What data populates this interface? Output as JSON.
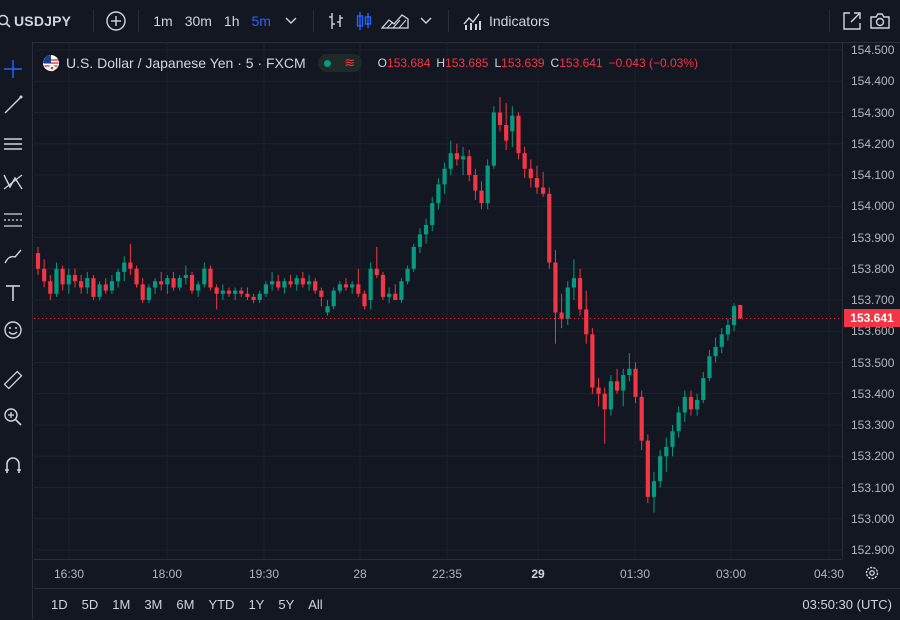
{
  "toolbar": {
    "symbol": "USDJPY",
    "intervals": [
      "1m",
      "30m",
      "1h",
      "5m"
    ],
    "active_interval": "5m",
    "indicators_label": "Indicators"
  },
  "legend": {
    "title": "U.S. Dollar / Japanese Yen · 5 · FXCM",
    "pill_symbol": "≋",
    "o_key": "O",
    "o_val": "153.684",
    "h_key": "H",
    "h_val": "153.685",
    "l_key": "L",
    "l_val": "153.639",
    "c_key": "C",
    "c_val": "153.641",
    "change": "−0.043 (−0.03%)"
  },
  "colors": {
    "up": "#089981",
    "down": "#f23645",
    "accent": "#2962ff",
    "background": "#131722"
  },
  "chart_data": {
    "type": "candlestick",
    "symbol": "USDJPY",
    "interval": "5",
    "ylim": [
      152.9,
      154.5
    ],
    "y_ticks": [
      "154.500",
      "154.400",
      "154.300",
      "154.200",
      "154.100",
      "154.000",
      "153.900",
      "153.800",
      "153.700",
      "153.600",
      "153.500",
      "153.400",
      "153.300",
      "153.200",
      "153.100",
      "153.000",
      "152.900"
    ],
    "x_ticks": [
      "16:30",
      "18:00",
      "19:30",
      "28",
      "22:35",
      "29",
      "01:30",
      "03:00",
      "04:30"
    ],
    "last_price": "153.641",
    "candles": [
      {
        "o": 153.85,
        "h": 153.87,
        "l": 153.78,
        "c": 153.8
      },
      {
        "o": 153.8,
        "h": 153.83,
        "l": 153.74,
        "c": 153.76
      },
      {
        "o": 153.76,
        "h": 153.78,
        "l": 153.7,
        "c": 153.72
      },
      {
        "o": 153.72,
        "h": 153.82,
        "l": 153.71,
        "c": 153.8
      },
      {
        "o": 153.8,
        "h": 153.81,
        "l": 153.73,
        "c": 153.75
      },
      {
        "o": 153.75,
        "h": 153.8,
        "l": 153.72,
        "c": 153.78
      },
      {
        "o": 153.78,
        "h": 153.8,
        "l": 153.74,
        "c": 153.76
      },
      {
        "o": 153.76,
        "h": 153.78,
        "l": 153.72,
        "c": 153.74
      },
      {
        "o": 153.74,
        "h": 153.79,
        "l": 153.72,
        "c": 153.77
      },
      {
        "o": 153.77,
        "h": 153.78,
        "l": 153.7,
        "c": 153.71
      },
      {
        "o": 153.71,
        "h": 153.76,
        "l": 153.7,
        "c": 153.75
      },
      {
        "o": 153.75,
        "h": 153.77,
        "l": 153.72,
        "c": 153.73
      },
      {
        "o": 153.73,
        "h": 153.78,
        "l": 153.72,
        "c": 153.76
      },
      {
        "o": 153.76,
        "h": 153.8,
        "l": 153.74,
        "c": 153.79
      },
      {
        "o": 153.79,
        "h": 153.84,
        "l": 153.76,
        "c": 153.82
      },
      {
        "o": 153.82,
        "h": 153.88,
        "l": 153.78,
        "c": 153.8
      },
      {
        "o": 153.8,
        "h": 153.81,
        "l": 153.74,
        "c": 153.75
      },
      {
        "o": 153.75,
        "h": 153.77,
        "l": 153.69,
        "c": 153.7
      },
      {
        "o": 153.7,
        "h": 153.75,
        "l": 153.69,
        "c": 153.74
      },
      {
        "o": 153.74,
        "h": 153.77,
        "l": 153.72,
        "c": 153.76
      },
      {
        "o": 153.76,
        "h": 153.79,
        "l": 153.73,
        "c": 153.75
      },
      {
        "o": 153.75,
        "h": 153.78,
        "l": 153.72,
        "c": 153.77
      },
      {
        "o": 153.77,
        "h": 153.79,
        "l": 153.73,
        "c": 153.74
      },
      {
        "o": 153.74,
        "h": 153.78,
        "l": 153.73,
        "c": 153.77
      },
      {
        "o": 153.77,
        "h": 153.81,
        "l": 153.75,
        "c": 153.78
      },
      {
        "o": 153.78,
        "h": 153.79,
        "l": 153.72,
        "c": 153.73
      },
      {
        "o": 153.73,
        "h": 153.76,
        "l": 153.71,
        "c": 153.75
      },
      {
        "o": 153.75,
        "h": 153.82,
        "l": 153.74,
        "c": 153.8
      },
      {
        "o": 153.8,
        "h": 153.81,
        "l": 153.73,
        "c": 153.74
      },
      {
        "o": 153.74,
        "h": 153.75,
        "l": 153.67,
        "c": 153.72
      },
      {
        "o": 153.72,
        "h": 153.75,
        "l": 153.7,
        "c": 153.73
      },
      {
        "o": 153.73,
        "h": 153.74,
        "l": 153.71,
        "c": 153.72
      },
      {
        "o": 153.72,
        "h": 153.74,
        "l": 153.7,
        "c": 153.73
      },
      {
        "o": 153.73,
        "h": 153.74,
        "l": 153.71,
        "c": 153.72
      },
      {
        "o": 153.72,
        "h": 153.74,
        "l": 153.7,
        "c": 153.71
      },
      {
        "o": 153.71,
        "h": 153.72,
        "l": 153.69,
        "c": 153.7
      },
      {
        "o": 153.7,
        "h": 153.73,
        "l": 153.69,
        "c": 153.72
      },
      {
        "o": 153.72,
        "h": 153.76,
        "l": 153.71,
        "c": 153.75
      },
      {
        "o": 153.75,
        "h": 153.79,
        "l": 153.73,
        "c": 153.76
      },
      {
        "o": 153.76,
        "h": 153.78,
        "l": 153.73,
        "c": 153.74
      },
      {
        "o": 153.74,
        "h": 153.77,
        "l": 153.72,
        "c": 153.76
      },
      {
        "o": 153.76,
        "h": 153.78,
        "l": 153.74,
        "c": 153.75
      },
      {
        "o": 153.75,
        "h": 153.78,
        "l": 153.73,
        "c": 153.77
      },
      {
        "o": 153.77,
        "h": 153.79,
        "l": 153.74,
        "c": 153.75
      },
      {
        "o": 153.75,
        "h": 153.78,
        "l": 153.73,
        "c": 153.76
      },
      {
        "o": 153.76,
        "h": 153.77,
        "l": 153.72,
        "c": 153.73
      },
      {
        "o": 153.73,
        "h": 153.74,
        "l": 153.68,
        "c": 153.71
      },
      {
        "o": 153.66,
        "h": 153.7,
        "l": 153.65,
        "c": 153.68
      },
      {
        "o": 153.68,
        "h": 153.74,
        "l": 153.67,
        "c": 153.73
      },
      {
        "o": 153.73,
        "h": 153.76,
        "l": 153.72,
        "c": 153.75
      },
      {
        "o": 153.75,
        "h": 153.77,
        "l": 153.73,
        "c": 153.74
      },
      {
        "o": 153.74,
        "h": 153.76,
        "l": 153.72,
        "c": 153.75
      },
      {
        "o": 153.75,
        "h": 153.8,
        "l": 153.71,
        "c": 153.72
      },
      {
        "o": 153.72,
        "h": 153.73,
        "l": 153.67,
        "c": 153.68
      },
      {
        "o": 153.7,
        "h": 153.82,
        "l": 153.67,
        "c": 153.8
      },
      {
        "o": 153.8,
        "h": 153.87,
        "l": 153.77,
        "c": 153.78
      },
      {
        "o": 153.78,
        "h": 153.79,
        "l": 153.7,
        "c": 153.71
      },
      {
        "o": 153.71,
        "h": 153.74,
        "l": 153.69,
        "c": 153.72
      },
      {
        "o": 153.72,
        "h": 153.75,
        "l": 153.7,
        "c": 153.7
      },
      {
        "o": 153.7,
        "h": 153.77,
        "l": 153.69,
        "c": 153.76
      },
      {
        "o": 153.76,
        "h": 153.81,
        "l": 153.75,
        "c": 153.8
      },
      {
        "o": 153.8,
        "h": 153.88,
        "l": 153.79,
        "c": 153.87
      },
      {
        "o": 153.87,
        "h": 153.93,
        "l": 153.85,
        "c": 153.91
      },
      {
        "o": 153.91,
        "h": 153.96,
        "l": 153.88,
        "c": 153.94
      },
      {
        "o": 153.94,
        "h": 154.03,
        "l": 153.92,
        "c": 154.01
      },
      {
        "o": 154.01,
        "h": 154.09,
        "l": 153.99,
        "c": 154.07
      },
      {
        "o": 154.07,
        "h": 154.14,
        "l": 154.04,
        "c": 154.12
      },
      {
        "o": 154.12,
        "h": 154.21,
        "l": 154.1,
        "c": 154.17
      },
      {
        "o": 154.17,
        "h": 154.2,
        "l": 154.13,
        "c": 154.15
      },
      {
        "o": 154.15,
        "h": 154.19,
        "l": 154.1,
        "c": 154.16
      },
      {
        "o": 154.16,
        "h": 154.18,
        "l": 154.08,
        "c": 154.1
      },
      {
        "o": 154.1,
        "h": 154.12,
        "l": 154.02,
        "c": 154.05
      },
      {
        "o": 154.05,
        "h": 154.08,
        "l": 153.99,
        "c": 154.01
      },
      {
        "o": 154.01,
        "h": 154.15,
        "l": 153.99,
        "c": 154.13
      },
      {
        "o": 154.13,
        "h": 154.32,
        "l": 154.12,
        "c": 154.3
      },
      {
        "o": 154.3,
        "h": 154.35,
        "l": 154.24,
        "c": 154.26
      },
      {
        "o": 154.26,
        "h": 154.33,
        "l": 154.18,
        "c": 154.21
      },
      {
        "o": 154.24,
        "h": 154.32,
        "l": 154.19,
        "c": 154.29
      },
      {
        "o": 154.29,
        "h": 154.3,
        "l": 154.15,
        "c": 154.17
      },
      {
        "o": 154.17,
        "h": 154.19,
        "l": 154.09,
        "c": 154.12
      },
      {
        "o": 154.12,
        "h": 154.15,
        "l": 154.06,
        "c": 154.09
      },
      {
        "o": 154.09,
        "h": 154.13,
        "l": 154.04,
        "c": 154.06
      },
      {
        "o": 154.06,
        "h": 154.11,
        "l": 154.03,
        "c": 154.04
      },
      {
        "o": 154.04,
        "h": 154.06,
        "l": 153.8,
        "c": 153.82
      },
      {
        "o": 153.82,
        "h": 153.86,
        "l": 153.56,
        "c": 153.66
      },
      {
        "o": 153.66,
        "h": 153.72,
        "l": 153.61,
        "c": 153.64
      },
      {
        "o": 153.64,
        "h": 153.76,
        "l": 153.62,
        "c": 153.74
      },
      {
        "o": 153.74,
        "h": 153.83,
        "l": 153.7,
        "c": 153.77
      },
      {
        "o": 153.77,
        "h": 153.8,
        "l": 153.65,
        "c": 153.67
      },
      {
        "o": 153.67,
        "h": 153.73,
        "l": 153.56,
        "c": 153.59
      },
      {
        "o": 153.59,
        "h": 153.61,
        "l": 153.4,
        "c": 153.42
      },
      {
        "o": 153.42,
        "h": 153.45,
        "l": 153.36,
        "c": 153.4
      },
      {
        "o": 153.4,
        "h": 153.42,
        "l": 153.24,
        "c": 153.35
      },
      {
        "o": 153.35,
        "h": 153.46,
        "l": 153.33,
        "c": 153.44
      },
      {
        "o": 153.44,
        "h": 153.48,
        "l": 153.4,
        "c": 153.41
      },
      {
        "o": 153.41,
        "h": 153.48,
        "l": 153.36,
        "c": 153.46
      },
      {
        "o": 153.46,
        "h": 153.53,
        "l": 153.44,
        "c": 153.48
      },
      {
        "o": 153.48,
        "h": 153.5,
        "l": 153.37,
        "c": 153.39
      },
      {
        "o": 153.39,
        "h": 153.41,
        "l": 153.22,
        "c": 153.25
      },
      {
        "o": 153.25,
        "h": 153.27,
        "l": 153.05,
        "c": 153.07
      },
      {
        "o": 153.07,
        "h": 153.15,
        "l": 153.02,
        "c": 153.12
      },
      {
        "o": 153.12,
        "h": 153.22,
        "l": 153.1,
        "c": 153.2
      },
      {
        "o": 153.2,
        "h": 153.26,
        "l": 153.15,
        "c": 153.23
      },
      {
        "o": 153.23,
        "h": 153.3,
        "l": 153.2,
        "c": 153.28
      },
      {
        "o": 153.28,
        "h": 153.36,
        "l": 153.26,
        "c": 153.34
      },
      {
        "o": 153.34,
        "h": 153.41,
        "l": 153.31,
        "c": 153.39
      },
      {
        "o": 153.39,
        "h": 153.41,
        "l": 153.33,
        "c": 153.35
      },
      {
        "o": 153.35,
        "h": 153.4,
        "l": 153.33,
        "c": 153.38
      },
      {
        "o": 153.38,
        "h": 153.47,
        "l": 153.37,
        "c": 153.45
      },
      {
        "o": 153.45,
        "h": 153.54,
        "l": 153.44,
        "c": 153.52
      },
      {
        "o": 153.52,
        "h": 153.58,
        "l": 153.5,
        "c": 153.55
      },
      {
        "o": 153.55,
        "h": 153.61,
        "l": 153.53,
        "c": 153.59
      },
      {
        "o": 153.59,
        "h": 153.64,
        "l": 153.57,
        "c": 153.62
      },
      {
        "o": 153.62,
        "h": 153.69,
        "l": 153.6,
        "c": 153.68
      },
      {
        "o": 153.684,
        "h": 153.685,
        "l": 153.639,
        "c": 153.641
      }
    ]
  },
  "bottom": {
    "ranges": [
      "1D",
      "5D",
      "1M",
      "3M",
      "6M",
      "YTD",
      "1Y",
      "5Y",
      "All"
    ],
    "clock": "03:50:30 (UTC)"
  }
}
